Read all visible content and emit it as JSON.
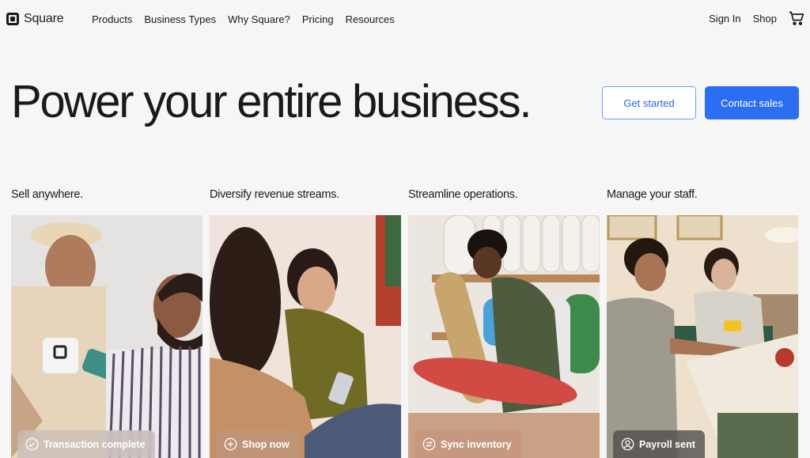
{
  "brand": {
    "name": "Square"
  },
  "nav": {
    "links": [
      "Products",
      "Business Types",
      "Why Square?",
      "Pricing",
      "Resources"
    ],
    "sign_in": "Sign In",
    "shop": "Shop",
    "cart_icon": "cart-icon"
  },
  "hero": {
    "title": "Power your entire business.",
    "get_started": "Get started",
    "contact_sales": "Contact sales"
  },
  "colors": {
    "accent": "#2c6ef2",
    "background": "#f6f6f6",
    "text": "#1a1a1a"
  },
  "features": [
    {
      "title": "Sell anywhere.",
      "chip": "Transaction complete",
      "icon": "check-circle-icon",
      "image": "barber-payment-photo"
    },
    {
      "title": "Diversify revenue streams.",
      "chip": "Shop now",
      "icon": "plus-circle-icon",
      "image": "shopping-phone-photo"
    },
    {
      "title": "Streamline operations.",
      "chip": "Sync inventory",
      "icon": "sync-circle-icon",
      "image": "skateboard-shop-photo"
    },
    {
      "title": "Manage your staff.",
      "chip": "Payroll sent",
      "icon": "user-circle-icon",
      "image": "cafe-staff-photo"
    }
  ]
}
